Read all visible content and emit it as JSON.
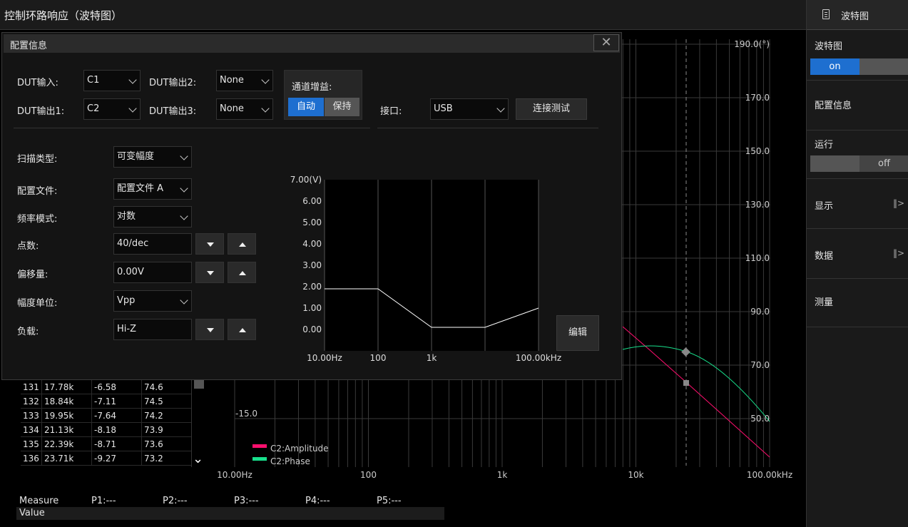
{
  "title": "控制环路响应（波特图）",
  "sidebar": {
    "header": "波特图",
    "bode": {
      "label": "波特图",
      "on": "on"
    },
    "config": "配置信息",
    "run": {
      "label": "运行",
      "off": "off"
    },
    "display": "显示",
    "data": "数据",
    "measure": "测量"
  },
  "dialog": {
    "title": "配置信息",
    "close": "✕",
    "dut_in": {
      "label": "DUT输入:",
      "value": "C1"
    },
    "dut_out1": {
      "label": "DUT输出1:",
      "value": "C2"
    },
    "dut_out2": {
      "label": "DUT输出2:",
      "value": "None"
    },
    "dut_out3": {
      "label": "DUT输出3:",
      "value": "None"
    },
    "gain": {
      "label": "通道增益:",
      "auto": "自动",
      "hold": "保持"
    },
    "port": {
      "label": "接口:",
      "value": "USB"
    },
    "connect": "连接测试",
    "sweep_type": {
      "label": "扫描类型:",
      "value": "可变幅度"
    },
    "config_file": {
      "label": "配置文件:",
      "value": "配置文件 A"
    },
    "freq_mode": {
      "label": "频率模式:",
      "value": "对数"
    },
    "points": {
      "label": "点数:",
      "value": "40/dec"
    },
    "offset": {
      "label": "偏移量:",
      "value": "0.00V"
    },
    "amp_unit": {
      "label": "幅度单位:",
      "value": "Vpp"
    },
    "load": {
      "label": "负载:",
      "value": "Hi-Z"
    },
    "edit": "编辑",
    "profile_chart": {
      "y_ticks": [
        "7.00(V)",
        "6.00",
        "5.00",
        "4.00",
        "3.00",
        "2.00",
        "1.00",
        "0.00"
      ],
      "x_ticks": [
        "10.00Hz",
        "100",
        "1k",
        "100.00kHz"
      ]
    }
  },
  "chart_data": {
    "type": "line",
    "x_ticks": [
      "10.00Hz",
      "100",
      "1k",
      "10k",
      "100.00kHz"
    ],
    "right_ticks": [
      "190.0(°)",
      "170.0",
      "150.0",
      "130.0",
      "110.0",
      "90.0",
      "70.0",
      "50.0"
    ],
    "left_tick": "-15.0",
    "series": [
      {
        "name": "C2:Amplitude",
        "color": "#ff0f6e"
      },
      {
        "name": "C2:Phase",
        "color": "#18e08c"
      }
    ],
    "profile": {
      "x": [
        10,
        100,
        1000,
        10000,
        100000
      ],
      "y": [
        1.9,
        1.9,
        0.1,
        0.1,
        1.0
      ]
    }
  },
  "table": {
    "rows": [
      [
        "131",
        "17.78k",
        "-6.58",
        "74.6"
      ],
      [
        "132",
        "18.84k",
        "-7.11",
        "74.5"
      ],
      [
        "133",
        "19.95k",
        "-7.64",
        "74.2"
      ],
      [
        "134",
        "21.13k",
        "-8.18",
        "73.9"
      ],
      [
        "135",
        "22.39k",
        "-8.71",
        "73.6"
      ],
      [
        "136",
        "23.71k",
        "-9.27",
        "73.2"
      ]
    ]
  },
  "measure": {
    "header": [
      "Measure",
      "P1:---",
      "P2:---",
      "P3:---",
      "P4:---",
      "P5:---"
    ],
    "value_label": "Value"
  }
}
